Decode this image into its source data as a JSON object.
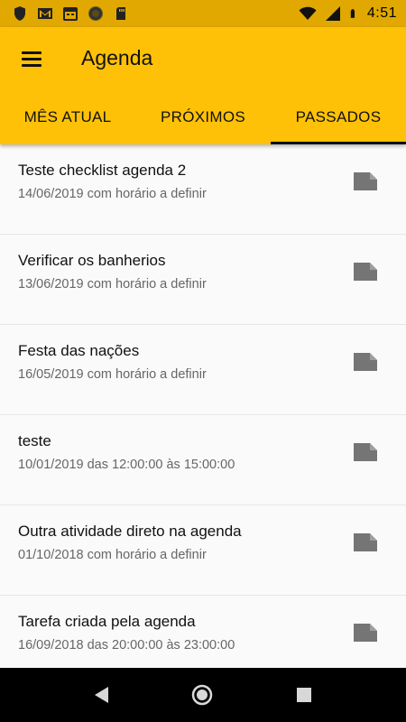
{
  "status_bar": {
    "time": "4:51",
    "left_icons": [
      "shield-icon",
      "gmail-icon",
      "calendar-icon",
      "circle-icon",
      "sd-card-icon"
    ],
    "right_icons": [
      "wifi-icon",
      "signal-icon",
      "battery-icon"
    ]
  },
  "app_bar": {
    "title": "Agenda",
    "menu_icon": "hamburger-menu-icon"
  },
  "tabs": [
    {
      "label": "MÊS ATUAL",
      "active": false
    },
    {
      "label": "PRÓXIMOS",
      "active": false
    },
    {
      "label": "PASSADOS",
      "active": true
    }
  ],
  "events": [
    {
      "title": "Teste checklist agenda 2",
      "subtitle": "14/06/2019 com horário a definir",
      "icon": "note-icon"
    },
    {
      "title": "Verificar os banherios",
      "subtitle": "13/06/2019 com horário a definir",
      "icon": "note-icon"
    },
    {
      "title": "Festa das nações",
      "subtitle": "16/05/2019 com horário a definir",
      "icon": "note-icon"
    },
    {
      "title": "teste",
      "subtitle": "10/01/2019 das 12:00:00 às 15:00:00",
      "icon": "note-icon"
    },
    {
      "title": "Outra atividade direto na agenda",
      "subtitle": "01/10/2018 com horário a definir",
      "icon": "note-icon"
    },
    {
      "title": "Tarefa criada pela agenda",
      "subtitle": "16/09/2018 das 20:00:00 às 23:00:00",
      "icon": "note-icon"
    }
  ],
  "nav_bar": {
    "buttons": [
      "back-icon",
      "home-icon",
      "recents-icon"
    ]
  },
  "colors": {
    "status_bar": "#E0A800",
    "app_bar": "#FFC107",
    "list_background": "#FAFAFA",
    "note_icon": "#757575",
    "nav_bar": "#000000"
  }
}
